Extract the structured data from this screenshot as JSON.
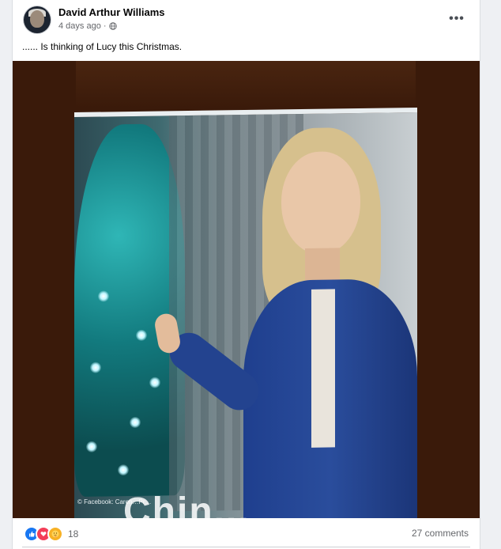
{
  "post": {
    "author": "David Arthur Williams",
    "time": "4 days ago",
    "separator": "·",
    "text": "...... Is thinking of Lucy this Christmas.",
    "more_label": "•••"
  },
  "photo": {
    "caption_watermark": "© Facebook: Caren…Pr…",
    "overlay_watermark": "Chin..."
  },
  "footer": {
    "reaction_count": "18",
    "comments": "27 comments"
  },
  "icons": {
    "avatar": "avatar",
    "privacy": "globe-icon",
    "more": "more-options-icon",
    "reactions": [
      "like-icon",
      "love-icon",
      "care-icon"
    ]
  },
  "colors": {
    "like": "#1877f2",
    "love": "#f33e58",
    "care": "#f7b125",
    "secondary_text": "#65676b",
    "photo_background": "#3a1a0a"
  }
}
